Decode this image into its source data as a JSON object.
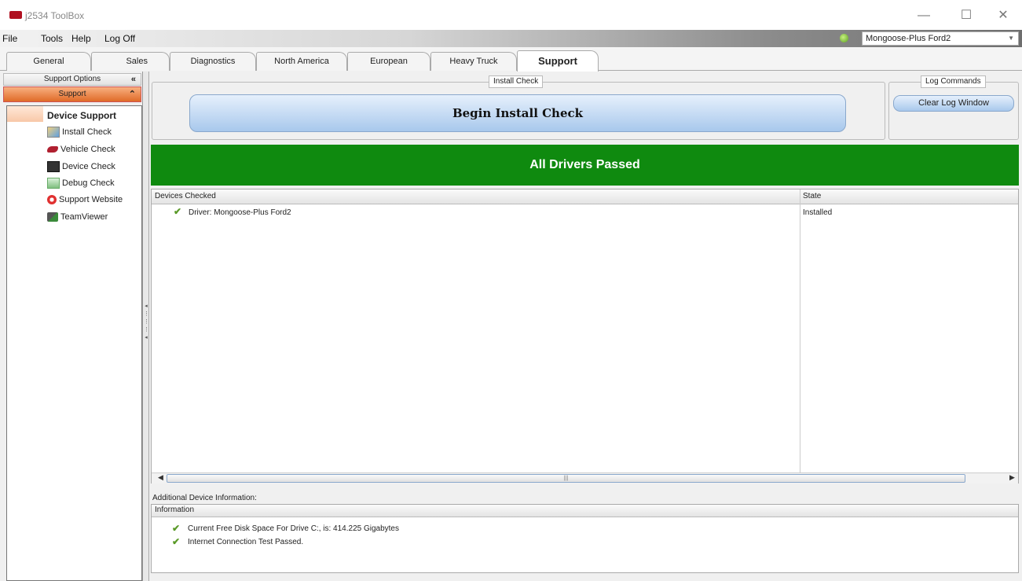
{
  "window": {
    "title": "j2534 ToolBox",
    "minimize": "—",
    "maximize": "☐",
    "close": "✕"
  },
  "menu": {
    "items": [
      "File",
      "Tools",
      "Help",
      "Log Off"
    ]
  },
  "device": {
    "selected": "Mongoose-Plus Ford2"
  },
  "tabs": [
    "General",
    "Sales",
    "Diagnostics",
    "North America",
    "European",
    "Heavy Truck",
    "Support"
  ],
  "active_tab": "Support",
  "sidebar": {
    "options_header": "Support Options",
    "section_header": "Support",
    "group_title": "Device Support",
    "items": [
      {
        "label": "Install Check",
        "icon": "install-check-icon"
      },
      {
        "label": "Vehicle Check",
        "icon": "vehicle-check-icon"
      },
      {
        "label": "Device Check",
        "icon": "device-check-icon"
      },
      {
        "label": "Debug Check",
        "icon": "debug-check-icon"
      },
      {
        "label": "Support Website",
        "icon": "lifebuoy-icon"
      },
      {
        "label": "TeamViewer",
        "icon": "teamviewer-icon"
      }
    ]
  },
  "install_check": {
    "legend": "Install Check",
    "button": "Begin Install Check"
  },
  "log_commands": {
    "legend": "Log Commands",
    "button": "Clear Log Window"
  },
  "status_banner": {
    "text": "All Drivers Passed",
    "color": "#0f8a0f"
  },
  "devices_table": {
    "columns": [
      "Devices Checked",
      "State"
    ],
    "rows": [
      {
        "name": "Driver: Mongoose-Plus Ford2",
        "state": "Installed"
      }
    ]
  },
  "additional_info": {
    "label": "Additional Device Information:",
    "column": "Information",
    "lines": [
      "Current Free Disk Space For Drive C:, is: 414.225 Gigabytes",
      "Internet Connection Test Passed."
    ]
  }
}
